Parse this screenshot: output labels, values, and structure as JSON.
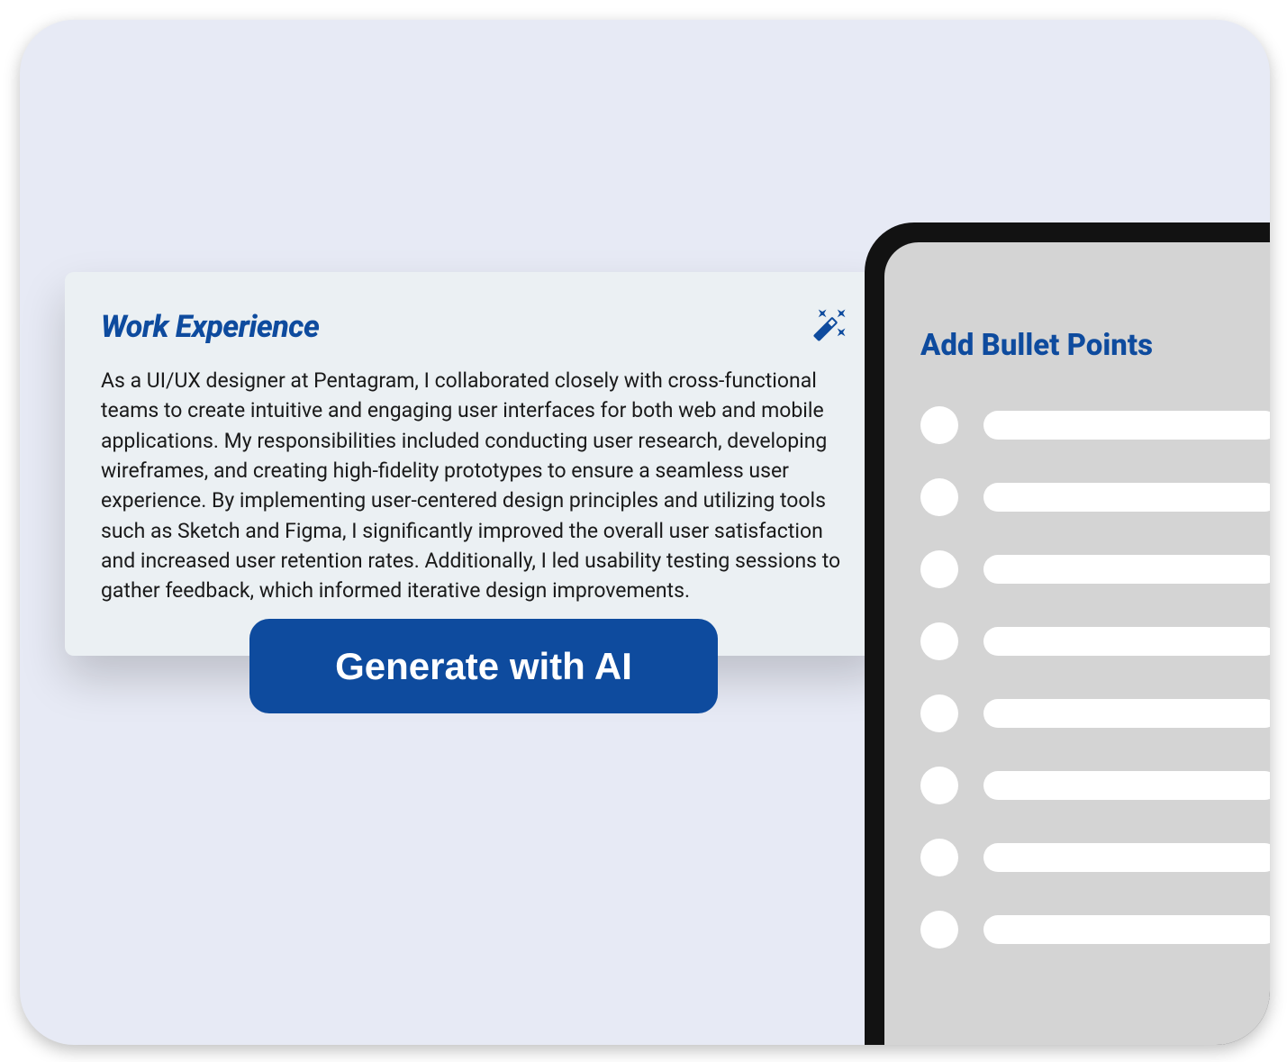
{
  "work_experience": {
    "title": "Work Experience",
    "body": "As a UI/UX designer at Pentagram, I collaborated closely with cross-functional teams to create intuitive and engaging user interfaces for both web and mobile applications. My responsibilities included conducting user research, developing wireframes, and creating high-fidelity prototypes to ensure a seamless user experience. By implementing user-centered design principles and utilizing tools such as Sketch and Figma, I significantly improved the overall user satisfaction and increased user retention rates. Additionally, I led usability testing sessions to gather feedback, which informed iterative design improvements."
  },
  "generate_button_label": "Generate with AI",
  "bullet_panel": {
    "title": "Add Bullet Points",
    "item_count": 8
  },
  "colors": {
    "accent": "#0E4B9E",
    "panel_bg": "#E7EAF5",
    "card_bg": "#EBF0F3",
    "phone_screen_bg": "#D4D4D4"
  }
}
